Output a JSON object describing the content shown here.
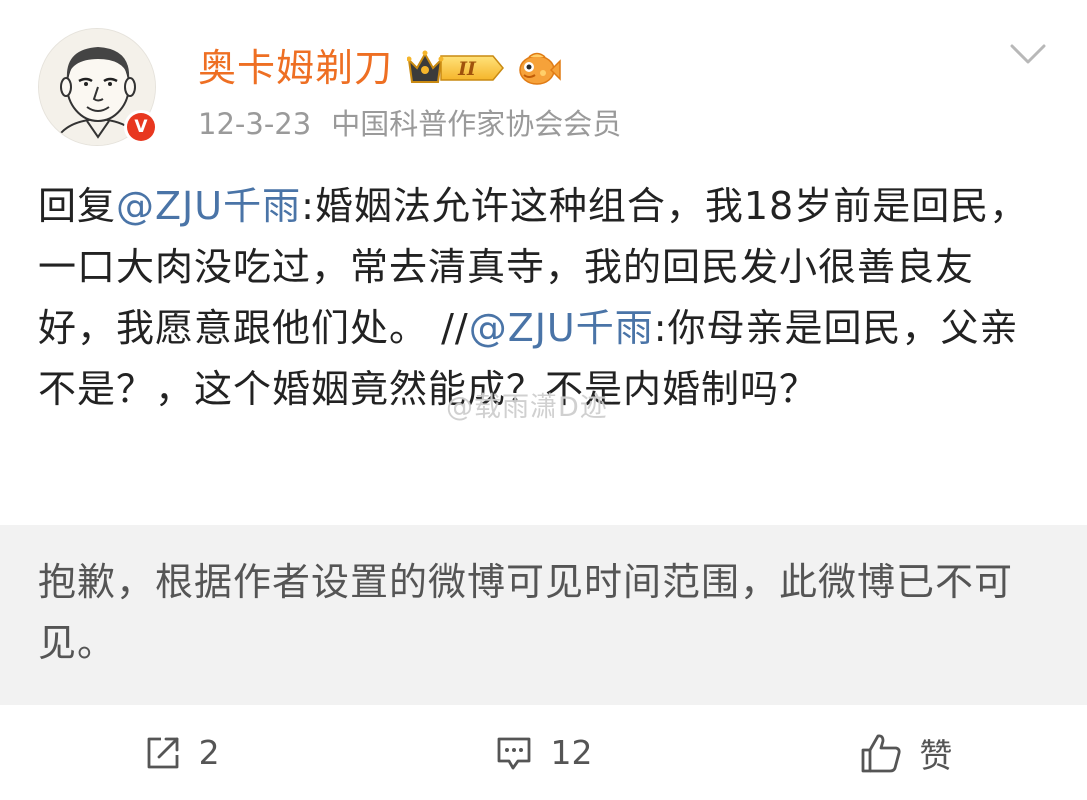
{
  "author": {
    "name": "奥卡姆剃刀",
    "level_badge": "II",
    "verified": true
  },
  "meta": {
    "date": "12-3-23",
    "description": "中国科普作家协会会员"
  },
  "post": {
    "segments": [
      {
        "text": "回复",
        "type": "plain"
      },
      {
        "text": "@ZJU千雨",
        "type": "mention"
      },
      {
        "text": ":婚姻法允许这种组合，我18岁前是回民，一口大肉没吃过，常去清真寺，我的回民发小很善良友好，我愿意跟他们处。 //",
        "type": "plain"
      },
      {
        "text": "@ZJU千雨",
        "type": "mention"
      },
      {
        "text": ":你母亲是回民，父亲不是？，这个婚姻竟然能成？不是内婚制吗？",
        "type": "plain"
      }
    ]
  },
  "watermark": "@载雨潇D迹",
  "notice": {
    "text": "抱歉，根据作者设置的微博可见时间范围，此微博已不可见。"
  },
  "actions": {
    "repost_count": "2",
    "comment_count": "12",
    "like_label": "赞"
  },
  "colors": {
    "username": "#ee6f23",
    "mention": "#4a74a7",
    "meta": "#9a9a9a",
    "notice_bg": "#f2f2f2",
    "verified": "#e8371f"
  },
  "icons": {
    "menu": "chevron-down-icon",
    "repost": "repost-icon",
    "comment": "comment-icon",
    "like": "thumbs-up-icon",
    "verified": "verified-v-icon",
    "level": "crown-level-icon",
    "vip": "fish-vip-icon"
  }
}
